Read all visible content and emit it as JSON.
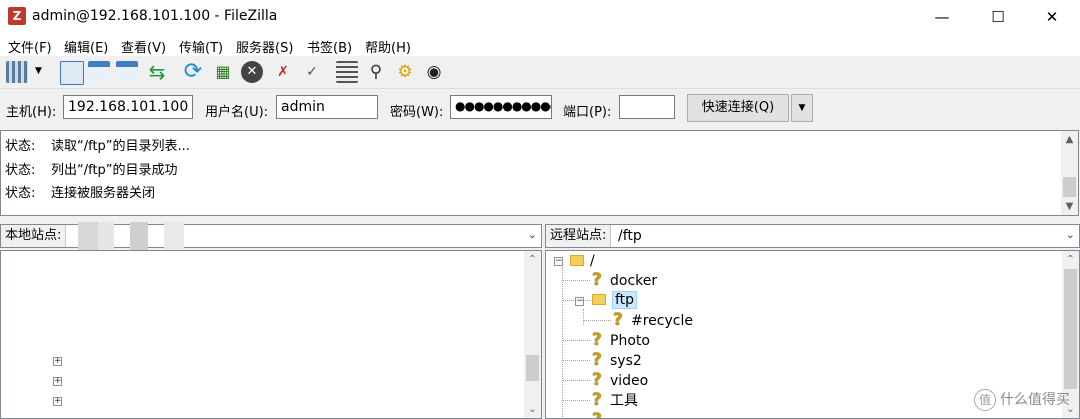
{
  "window": {
    "title": "admin@192.168.101.100 - FileZilla",
    "app_icon_glyph": "Z"
  },
  "menu": [
    "文件(F)",
    "编辑(E)",
    "查看(V)",
    "传输(T)",
    "服务器(S)",
    "书签(B)",
    "帮助(H)"
  ],
  "quickconnect": {
    "host_label": "主机(H):",
    "host_value": "192.168.101.100",
    "user_label": "用户名(U):",
    "user_value": "admin",
    "pass_label": "密码(W):",
    "pass_value": "●●●●●●●●●●●",
    "port_label": "端口(P):",
    "port_value": "",
    "connect_label": "快速连接(Q)"
  },
  "log": [
    {
      "key": "状态:",
      "msg": "读取“/ftp”的目录列表..."
    },
    {
      "key": "状态:",
      "msg": "列出“/ftp”的目录成功"
    },
    {
      "key": "状态:",
      "msg": "连接被服务器关闭"
    }
  ],
  "local": {
    "label": "本地站点:",
    "path": ""
  },
  "remote": {
    "label": "远程站点:",
    "path": "/ftp",
    "tree": {
      "root": "/",
      "items": [
        "docker",
        "ftp",
        "#recycle",
        "Photo",
        "sys2",
        "video",
        "工具"
      ]
    }
  },
  "watermark": {
    "badge": "值",
    "text": "什么值得买"
  },
  "colors": {
    "selection": "#cce8ff",
    "folder": "#f3cf5c",
    "accent": "#0078d7"
  }
}
